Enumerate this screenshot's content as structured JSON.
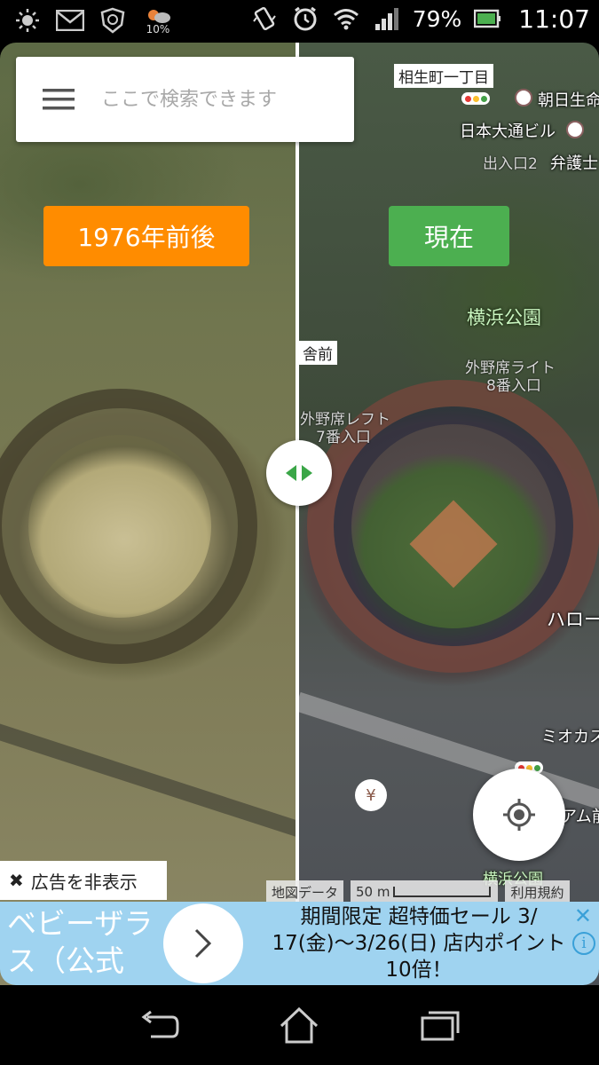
{
  "status_bar": {
    "battery_percent": "79%",
    "time": "11:07",
    "weather_percent": "10%",
    "icons": [
      "brightness-icon",
      "gmail-icon",
      "shield-icon",
      "weather-icon",
      "vibrate-icon",
      "alarm-icon",
      "wifi-icon",
      "signal-icon",
      "battery-icon"
    ]
  },
  "search": {
    "placeholder": "ここで検索できます"
  },
  "era_toggle": {
    "old_label": "1976年前後",
    "now_label": "現在",
    "old_color": "#ff8c00",
    "now_color": "#4caf50"
  },
  "map_labels": {
    "aioi": "相生町一丁目",
    "asahi": "朝日生命",
    "nihon_odori": "日本大通ビル",
    "exit2": "出入口2",
    "bengoshi": "弁護士",
    "yokohama_park": "横浜公園",
    "gaiya_right": "外野席ライト",
    "gate8": "8番入口",
    "gaiya_left": "外野席レフト",
    "gate7": "7番入口",
    "shamae": "舎前",
    "hello": "ハロー",
    "mioka": "ミオカス",
    "amu": "アム前",
    "yokohama_park_bottom": "横浜公園"
  },
  "map_controls": {
    "map_data": "地図データ",
    "scale": "50 m",
    "terms": "利用規約",
    "hide_ads": "広告を非表示"
  },
  "ad": {
    "left_text": "ベビーザラス（公式",
    "line1": "期間限定 超特価セール 3/",
    "line2": "17(金)〜3/26(日) 店内ポイント",
    "line3": "10倍！",
    "close": "✕",
    "info": "i"
  }
}
